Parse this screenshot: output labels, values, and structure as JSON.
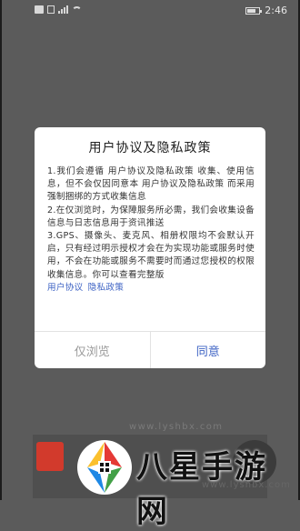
{
  "status_bar": {
    "time": "2:46"
  },
  "dialog": {
    "title": "用户协议及隐私政策",
    "paragraphs": [
      "1.我们会遵循 用户协议及隐私政策 收集、使用信息，但不会仅因同意本 用户协议及隐私政策 而采用强制捆绑的方式收集信息",
      "2.在仅浏览时，为保障服务所必需，我们会收集设备信息与日志信息用于资讯推送",
      "3.GPS、摄像头、麦克风、相册权限均不会默认开启，只有经过明示授权才会在为实现功能或服务时使用，不会在功能或服务不需要时而通过您授权的权限收集信息。你可以查看完整版"
    ],
    "link_user_agreement": "用户协议",
    "link_privacy_policy": "隐私政策",
    "button_browse": "仅浏览",
    "button_agree": "同意"
  },
  "watermark": {
    "brand": "八星手游网",
    "url": "www.lyshbx.com"
  },
  "colors": {
    "overlay": "#5b5b5b",
    "link": "#3e63c4",
    "secondary_button": "#9a9a9a"
  }
}
